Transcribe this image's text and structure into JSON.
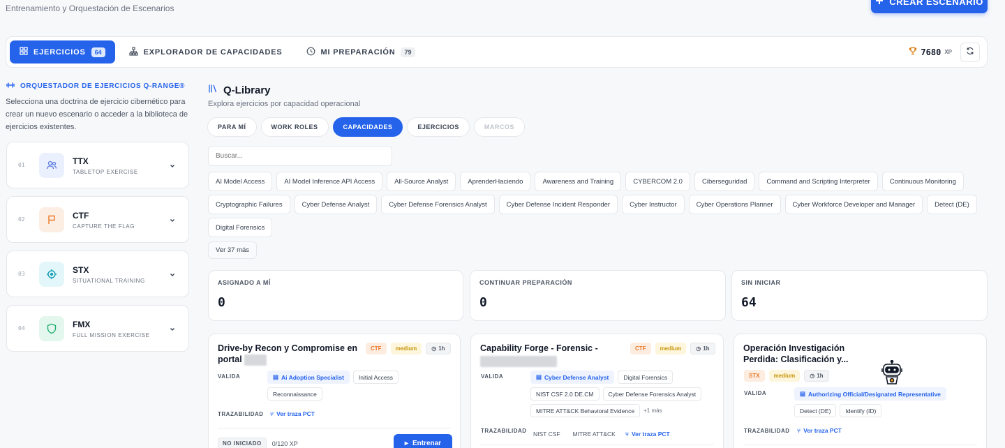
{
  "header": {
    "subtitle": "Entrenamiento y Orquestación de Escenarios",
    "create_label": "CREAR ESCENARIO"
  },
  "nav": {
    "tabs": [
      {
        "label": "EJERCICIOS",
        "count": "64",
        "icon": "grid-icon",
        "active": true
      },
      {
        "label": "EXPLORADOR DE CAPACIDADES",
        "count": "",
        "icon": "hierarchy-icon",
        "active": false
      },
      {
        "label": "MI PREPARACIÓN",
        "count": "79",
        "icon": "clock-icon",
        "active": false
      }
    ],
    "xp_value": "7680",
    "xp_unit": "XP"
  },
  "sidebar": {
    "heading": "ORQUESTADOR DE EJERCICIOS Q-RANGE®",
    "description": "Selecciona una doctrina de ejercicio cibernético para crear un nuevo escenario o acceder a la biblioteca de ejercicios existentes.",
    "exercises": [
      {
        "num": "01",
        "name": "TTX",
        "sub": "TABLETOP EXERCISE",
        "icon": "users-icon",
        "color": "#5b7be0",
        "bg": "#eaf0fd"
      },
      {
        "num": "02",
        "name": "CTF",
        "sub": "CAPTURE THE FLAG",
        "icon": "flag-icon",
        "color": "#ea7a2a",
        "bg": "#fdeee4"
      },
      {
        "num": "03",
        "name": "STX",
        "sub": "SITUATIONAL TRAINING",
        "icon": "crosshair-icon",
        "color": "#1aa0b8",
        "bg": "#e3f6f9"
      },
      {
        "num": "04",
        "name": "FMX",
        "sub": "FULL MISSION EXERCISE",
        "icon": "shield-icon",
        "color": "#1fae6e",
        "bg": "#e3f7ee"
      }
    ]
  },
  "library": {
    "title": "Q-Library",
    "description": "Explora ejercicios por capacidad operacional",
    "filters": [
      {
        "label": "PARA MÍ",
        "state": "normal"
      },
      {
        "label": "WORK ROLES",
        "state": "normal"
      },
      {
        "label": "CAPACIDADES",
        "state": "active"
      },
      {
        "label": "EJERCICIOS",
        "state": "normal"
      },
      {
        "label": "MARCOS",
        "state": "dim"
      }
    ],
    "search_placeholder": "Buscar...",
    "chips": [
      "AI Model Access",
      "AI Model Inference API Access",
      "All-Source Analyst",
      "AprenderHaciendo",
      "Awareness and Training",
      "CYBERCOM 2.0",
      "Ciberseguridad",
      "Command and Scripting Interpreter",
      "Continuous Monitoring",
      "Cryptographic Failures",
      "Cyber Defense Analyst",
      "Cyber Defense Forensics Analyst",
      "Cyber Defense Incident Responder",
      "Cyber Instructor",
      "Cyber Operations Planner",
      "Cyber Workforce Developer and Manager",
      "Detect (DE)",
      "Digital Forensics"
    ],
    "see_more": "Ver 37 más"
  },
  "stats": [
    {
      "label": "ASIGNADO A MÍ",
      "value": "0"
    },
    {
      "label": "CONTINUAR PREPARACIÓN",
      "value": "0"
    },
    {
      "label": "SIN INICIAR",
      "value": "64"
    }
  ],
  "labels": {
    "valida": "VALIDA",
    "trazabilidad": "TRAZABILIDAD",
    "ver_traza": "Ver traza PCT"
  },
  "cards": [
    {
      "title": "Drive-by Recon y Compromise en portal",
      "type": "CTF",
      "difficulty": "medium",
      "duration": "1h",
      "primary": "Ai Adoption Specialist",
      "validates": [
        "Initial Access",
        "Reconnaissance"
      ],
      "status": "NO INICIADO",
      "xp": "0/120 XP",
      "action": "Entrenar"
    },
    {
      "title": "Capability Forge - Forensic -",
      "type": "CTF",
      "difficulty": "medium",
      "duration": "1h",
      "primary": "Cyber Defense Analyst",
      "validates": [
        "Digital Forensics",
        "NIST CSF 2.0 DE.CM",
        "Cyber Defense Forensics Analyst",
        "MITRE ATT&CK Behavioral Evidence"
      ],
      "more": "+1 más",
      "frameworks": [
        "NIST CSF",
        "MITRE ATT&CK"
      ]
    },
    {
      "title": "Operación Investigación Perdida: Clasificación y...",
      "type": "STX",
      "difficulty": "medium",
      "duration": "1h",
      "primary": "Authorizing Official/Designated Representative",
      "validates": [
        "Detect (DE)",
        "Identify (ID)"
      ]
    }
  ]
}
